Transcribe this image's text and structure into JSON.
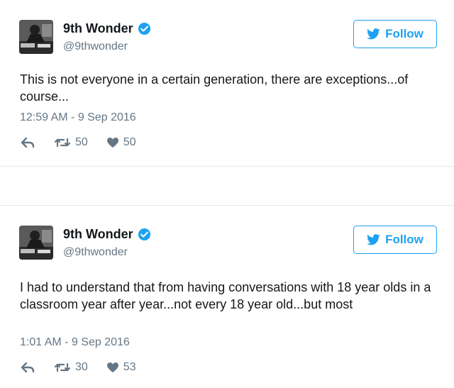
{
  "tweets": [
    {
      "author": {
        "name": "9th Wonder",
        "handle": "@9thwonder"
      },
      "follow_label": "Follow",
      "text": "This is not everyone in a certain generation, there are exceptions...of course...",
      "timestamp": "12:59 AM - 9 Sep 2016",
      "retweets": "50",
      "likes": "50"
    },
    {
      "author": {
        "name": "9th Wonder",
        "handle": "@9thwonder"
      },
      "follow_label": "Follow",
      "text": "I had to understand that from having conversations with 18 year olds in a classroom year after year...not every 18 year old...but most",
      "timestamp": "1:01 AM - 9 Sep 2016",
      "retweets": "30",
      "likes": "53"
    }
  ],
  "icons": {
    "verified": "verified-badge-icon",
    "bird": "twitter-bird-icon",
    "reply": "reply-icon",
    "retweet": "retweet-icon",
    "like": "heart-icon"
  },
  "colors": {
    "accent": "#1da1f2",
    "text": "#14171a",
    "muted": "#657786",
    "divider": "#e1e8ed"
  }
}
